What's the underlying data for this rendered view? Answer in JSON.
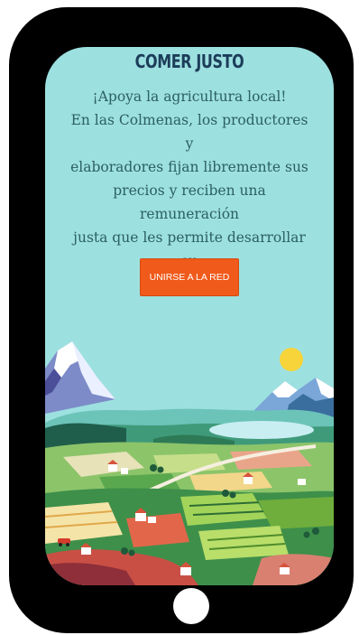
{
  "brand": {
    "title": "COMER JUSTO"
  },
  "intro": {
    "lines": [
      "¡Apoya la agricultura local!",
      "En las Colmenas, los productores y",
      "elaboradores fijan libremente sus",
      "precios y reciben una remuneración",
      "justa que les permite desarrollar su",
      "actividad."
    ]
  },
  "cta": {
    "label": "UNIRSE A LA RED"
  },
  "colors": {
    "screen_background": "#9de0e0",
    "title_color": "#1c3d5a",
    "text_color": "#2b5f66",
    "button_color": "#f05a1a",
    "phone_frame": "#000000"
  },
  "illustration": {
    "name": "farm-landscape-illustration"
  }
}
